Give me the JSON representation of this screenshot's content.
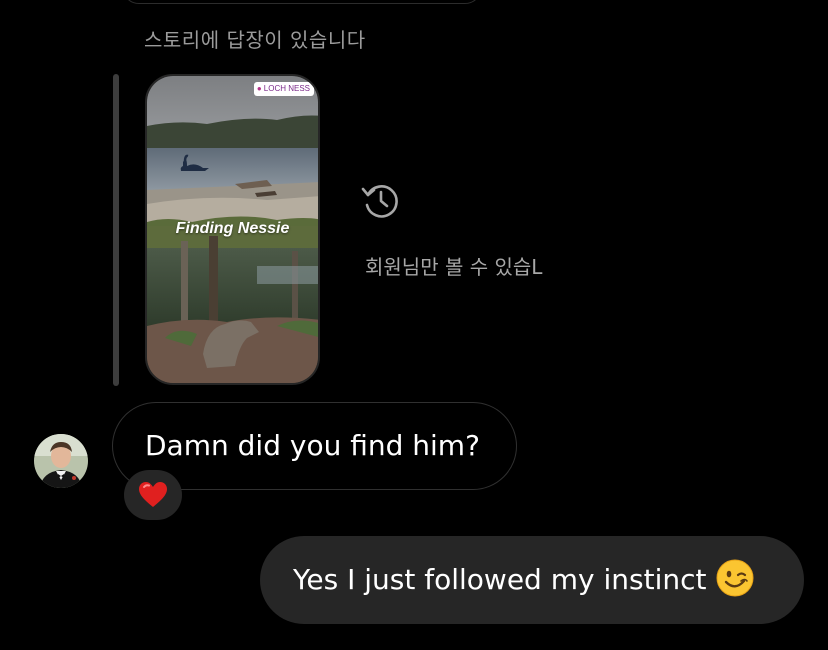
{
  "thread": {
    "story_reply_label": "스토리에 답장이 있습니다",
    "story": {
      "location_sticker": "LOCH NESS",
      "caption": "Finding Nessie"
    },
    "members_only_text": "회원님만 볼 수 있습L",
    "messages": [
      {
        "direction": "incoming",
        "text": "Damn did you find him?",
        "reaction": "heart"
      },
      {
        "direction": "outgoing",
        "text": "Yes I just followed my instinct",
        "emoji": "winking-face"
      }
    ]
  },
  "colors": {
    "background": "#000000",
    "outgoing_bubble": "#262626",
    "incoming_bubble_border": "#303030",
    "muted_text": "#9b9b9b",
    "reaction_heart": "#e0201f"
  }
}
